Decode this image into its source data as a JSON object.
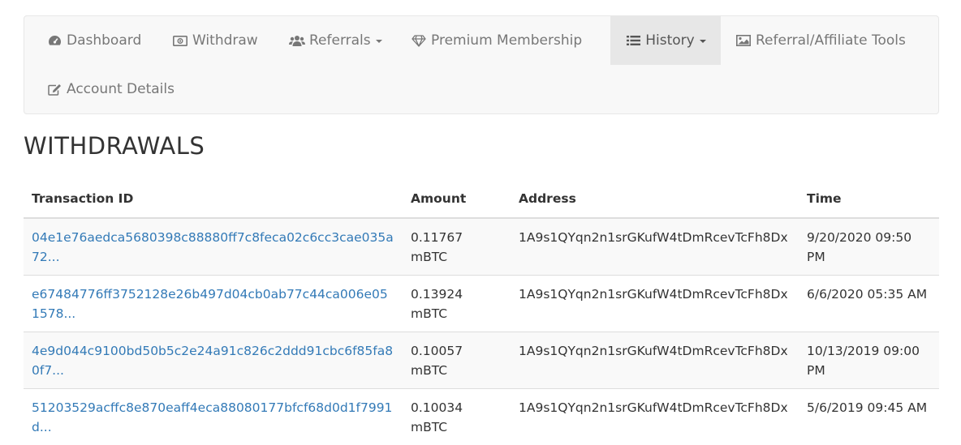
{
  "nav": {
    "items": [
      {
        "label": "Dashboard",
        "icon": "dashboard-icon"
      },
      {
        "label": "Withdraw",
        "icon": "money-icon"
      },
      {
        "label": "Referrals",
        "icon": "users-icon",
        "dropdown": true
      },
      {
        "label": "Premium Membership",
        "icon": "diamond-icon"
      },
      {
        "label": "History",
        "icon": "list-icon",
        "dropdown": true,
        "active": true
      },
      {
        "label": "Referral/Affiliate Tools",
        "icon": "image-icon"
      },
      {
        "label": "Account Details",
        "icon": "edit-icon"
      }
    ]
  },
  "page": {
    "title": "WITHDRAWALS"
  },
  "table": {
    "headers": [
      "Transaction ID",
      "Amount",
      "Address",
      "Time"
    ],
    "rows": [
      {
        "txid": "04e1e76aedca5680398c88880ff7c8feca02c6cc3cae035a72...",
        "amount": "0.11767 mBTC",
        "address": "1A9s1QYqn2n1srGKufW4tDmRcevTcFh8Dx",
        "time": "9/20/2020 09:50 PM"
      },
      {
        "txid": "e67484776ff3752128e26b497d04cb0ab77c44ca006e051578...",
        "amount": "0.13924 mBTC",
        "address": "1A9s1QYqn2n1srGKufW4tDmRcevTcFh8Dx",
        "time": "6/6/2020 05:35 AM"
      },
      {
        "txid": "4e9d044c9100bd50b5c2e24a91c826c2ddd91cbc6f85fa80f7...",
        "amount": "0.10057 mBTC",
        "address": "1A9s1QYqn2n1srGKufW4tDmRcevTcFh8Dx",
        "time": "10/13/2019 09:00 PM"
      },
      {
        "txid": "51203529acffc8e870eaff4eca88080177bfcf68d0d1f7991d...",
        "amount": "0.10034 mBTC",
        "address": "1A9s1QYqn2n1srGKufW4tDmRcevTcFh8Dx",
        "time": "5/6/2019 09:45 AM"
      }
    ]
  },
  "colors": {
    "link": "#337ab7",
    "navbar_bg": "#f8f8f8",
    "active_bg": "#e7e7e7"
  }
}
